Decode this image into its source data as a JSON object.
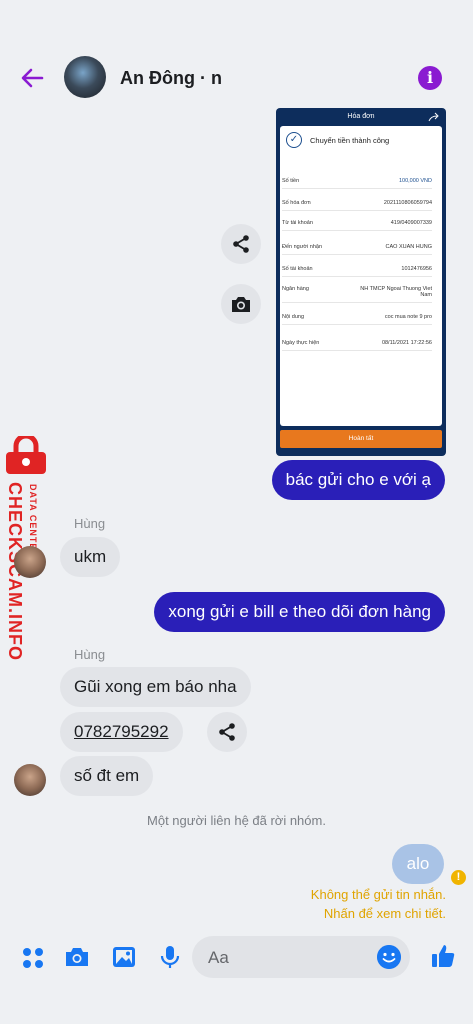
{
  "header": {
    "title": "An Đông · n"
  },
  "receipt": {
    "header_title": "Hóa đơn",
    "status": "Chuyển tiền thành công",
    "rows": [
      {
        "label": "Số tiền",
        "value": "100,000 VND"
      },
      {
        "label": "Số hóa đơn",
        "value": "2021110806059794"
      },
      {
        "label": "Từ tài khoản",
        "value": "419/0409007339"
      },
      {
        "label": "Đến người nhận",
        "value": "CAO XUAN HUNG"
      },
      {
        "label": "Số tài khoản",
        "value": "1012476956"
      },
      {
        "label": "Ngân hàng",
        "value": "NH TMCP Ngoai Thuong Viet Nam"
      },
      {
        "label": "Nội dung",
        "value": "coc mua note 9 pro"
      },
      {
        "label": "Ngày thực hiện",
        "value": "08/11/2021 17:22:56"
      }
    ],
    "button": "Hoàn tất"
  },
  "messages": {
    "out1": "bác gửi cho e với ạ",
    "sender1": "Hùng",
    "in1": "ukm",
    "out2": "xong gửi e bill e theo dõi đơn hàng",
    "sender2": "Hùng",
    "in2": "Gũi xong em báo nha",
    "in3": "0782795292",
    "in4": "số đt em",
    "system": "Một người liên hệ đã rời nhóm.",
    "out3": "alo",
    "fail_line1": "Không thể gửi tin nhắn.",
    "fail_line2": "Nhấn để xem chi tiết."
  },
  "watermark": {
    "main": "CHECKSCAM.INFO",
    "sub": "DATA CENTER"
  },
  "composer": {
    "placeholder": "Aa"
  },
  "colors": {
    "accent": "#8a1bd1",
    "outgoing": "#2a1fb8",
    "icon_blue": "#1877f2",
    "warning": "#e0a400"
  },
  "icons": [
    "back-arrow-icon",
    "info-icon",
    "share-icon",
    "camera-icon",
    "apps-icon",
    "photo-icon",
    "mic-icon",
    "emoji-icon",
    "like-icon",
    "warning-icon",
    "lock-icon"
  ]
}
